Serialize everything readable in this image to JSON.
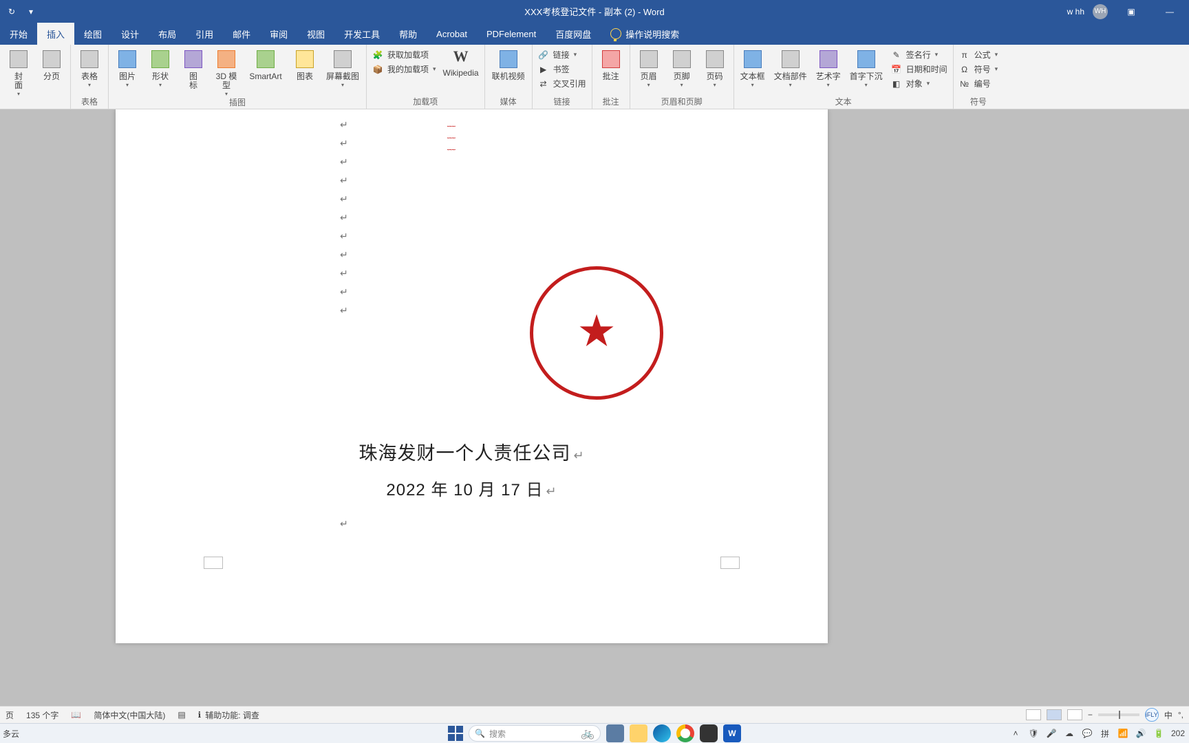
{
  "title": "XXX考核登记文件 - 副本 (2)  -  Word",
  "user": {
    "name": "w hh",
    "initials": "WH"
  },
  "tabs": [
    {
      "label": "开始"
    },
    {
      "label": "插入"
    },
    {
      "label": "绘图"
    },
    {
      "label": "设计"
    },
    {
      "label": "布局"
    },
    {
      "label": "引用"
    },
    {
      "label": "邮件"
    },
    {
      "label": "审阅"
    },
    {
      "label": "视图"
    },
    {
      "label": "开发工具"
    },
    {
      "label": "帮助"
    },
    {
      "label": "Acrobat"
    },
    {
      "label": "PDFelement"
    },
    {
      "label": "百度网盘"
    }
  ],
  "tell_me": "操作说明搜索",
  "ribbon": {
    "pages": {
      "cover": "封\n面",
      "break": "分页",
      "label": ""
    },
    "tables": {
      "table": "表格",
      "label": "表格"
    },
    "illus": {
      "pic": "图片",
      "shapes": "形状",
      "icons": "图\n标",
      "model": "3D 模\n型",
      "smartart": "SmartArt",
      "chart": "图表",
      "screenshot": "屏幕截图",
      "label": "插图"
    },
    "addins": {
      "get": "获取加载项",
      "my": "我的加载项",
      "wiki": "Wikipedia",
      "label": "加载项"
    },
    "media": {
      "video": "联机视频",
      "label": "媒体"
    },
    "links": {
      "link": "链接",
      "bookmark": "书签",
      "xref": "交叉引用",
      "label": "链接"
    },
    "comments": {
      "comment": "批注",
      "label": "批注"
    },
    "hf": {
      "header": "页眉",
      "footer": "页脚",
      "pageno": "页码",
      "label": "页眉和页脚"
    },
    "text": {
      "textbox": "文本框",
      "parts": "文档部件",
      "wordart": "艺术字",
      "dropcap": "首字下沉",
      "sig": "签名行",
      "dt": "日期和时间",
      "obj": "对象",
      "label": "文本"
    },
    "symbols": {
      "eq": "公式",
      "sym": "符号",
      "num": "编号",
      "label": "符号"
    }
  },
  "doc": {
    "company": "珠海发财一个人责任公司",
    "date": "2022 年 10 月 17 日",
    "return_mark": "↵"
  },
  "status": {
    "page": "页",
    "words": "135 个字",
    "lang": "简体中文(中国大陆)",
    "a11y": "辅助功能: 调查",
    "ime_badge": "iFLY",
    "ime": "中",
    "clock": "202"
  },
  "taskbar": {
    "weather": "多云",
    "search_placeholder": "搜索"
  }
}
